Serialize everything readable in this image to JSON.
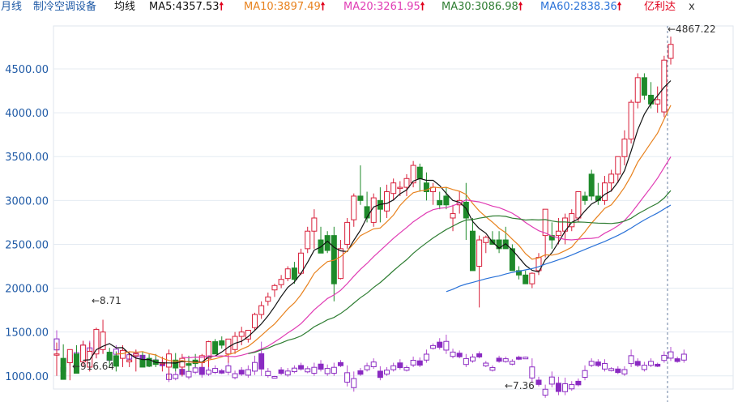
{
  "legend": {
    "period": "月线",
    "name": "制冷空调设备",
    "type": "均线",
    "ma5": {
      "label": "MA5:4357.53",
      "color": "#111111"
    },
    "ma10": {
      "label": "MA10:3897.49",
      "color": "#e8821e"
    },
    "ma20": {
      "label": "MA20:3261.95",
      "color": "#e03cb4"
    },
    "ma30": {
      "label": "MA30:3086.98",
      "color": "#2e7d32"
    },
    "ma60": {
      "label": "MA60:2838.36",
      "color": "#2a72d8"
    },
    "up_arrow": "🠕",
    "extra": "亿利达",
    "close": "x"
  },
  "chart_data": {
    "type": "candlestick",
    "ylim": [
      850,
      4990
    ],
    "y_ticks": [
      "1000.00",
      "1500.00",
      "2000.00",
      "2500.00",
      "3000.00",
      "3500.00",
      "4000.00",
      "4500.00"
    ],
    "up_color": "#d81f3a",
    "down_color": "#1e8a2a",
    "candles": [
      [
        1250,
        1380,
        1000,
        1250
      ],
      [
        1200,
        1360,
        1050,
        960
      ],
      [
        1150,
        1280,
        950,
        1300
      ],
      [
        1250,
        1350,
        1150,
        1030
      ],
      [
        1160,
        1400,
        1100,
        1350
      ],
      [
        1100,
        1380,
        1050,
        1280
      ],
      [
        1250,
        1550,
        1200,
        1530
      ],
      [
        1300,
        1640,
        1250,
        1500
      ],
      [
        1270,
        1320,
        1100,
        1180
      ],
      [
        1230,
        1280,
        1050,
        1110
      ],
      [
        1200,
        1350,
        1100,
        1290
      ],
      [
        1160,
        1250,
        1100,
        1180
      ],
      [
        1230,
        1300,
        1050,
        1250
      ],
      [
        1180,
        1280,
        1100,
        1100
      ],
      [
        1200,
        1250,
        1100,
        1110
      ],
      [
        1180,
        1250,
        1100,
        1130
      ],
      [
        1150,
        1220,
        1050,
        1150
      ],
      [
        1100,
        1300,
        960,
        1250
      ],
      [
        1180,
        1260,
        1050,
        1090
      ],
      [
        1100,
        1250,
        1000,
        1200
      ],
      [
        1140,
        1230,
        1050,
        1120
      ],
      [
        1180,
        1250,
        1100,
        1140
      ],
      [
        1150,
        1250,
        1100,
        1230
      ],
      [
        1200,
        1400,
        1100,
        1390
      ],
      [
        1390,
        1420,
        1350,
        1250
      ],
      [
        1400,
        1450,
        1310,
        1350
      ],
      [
        1250,
        1300,
        1150,
        1420
      ],
      [
        1300,
        1500,
        1250,
        1450
      ],
      [
        1450,
        1560,
        1350,
        1500
      ],
      [
        1420,
        1480,
        1380,
        1520
      ],
      [
        1550,
        1720,
        1520,
        1700
      ],
      [
        1700,
        1850,
        1650,
        1800
      ],
      [
        1850,
        1950,
        1800,
        1900
      ],
      [
        1980,
        2050,
        1900,
        2030
      ],
      [
        2040,
        2150,
        2000,
        2100
      ],
      [
        2110,
        2250,
        2080,
        2220
      ],
      [
        2230,
        2300,
        2050,
        2100
      ],
      [
        2170,
        2450,
        2150,
        2400
      ],
      [
        2450,
        2700,
        2400,
        2650
      ],
      [
        2650,
        2900,
        2450,
        2800
      ],
      [
        2550,
        2700,
        2400,
        2400
      ],
      [
        2600,
        2650,
        2400,
        2430
      ],
      [
        2600,
        2700,
        1850,
        2050
      ],
      [
        2110,
        2550,
        2100,
        2450
      ],
      [
        2500,
        2800,
        2450,
        2750
      ],
      [
        2780,
        3080,
        2700,
        3050
      ],
      [
        3050,
        3400,
        2950,
        3000
      ],
      [
        2930,
        3100,
        2750,
        2800
      ],
      [
        2750,
        3080,
        2700,
        3030
      ],
      [
        3000,
        3150,
        2750,
        2900
      ],
      [
        2880,
        3180,
        2800,
        3100
      ],
      [
        3080,
        3250,
        3000,
        3200
      ],
      [
        3150,
        3220,
        3050,
        3150
      ],
      [
        3150,
        3300,
        3050,
        3250
      ],
      [
        3200,
        3450,
        3150,
        3400
      ],
      [
        3380,
        3420,
        3100,
        3250
      ],
      [
        3200,
        3320,
        3000,
        3100
      ],
      [
        3100,
        3200,
        2950,
        3150
      ],
      [
        3000,
        3100,
        2900,
        2950
      ],
      [
        3050,
        3150,
        2900,
        2950
      ],
      [
        2800,
        2950,
        2650,
        2850
      ],
      [
        2950,
        3100,
        2850,
        3000
      ],
      [
        2980,
        3200,
        2550,
        2800
      ],
      [
        2650,
        2800,
        2200,
        2200
      ],
      [
        2250,
        2600,
        1780,
        2550
      ],
      [
        2520,
        2600,
        2400,
        2580
      ],
      [
        2550,
        2650,
        2500,
        2500
      ],
      [
        2550,
        2650,
        2400,
        2450
      ],
      [
        2550,
        2700,
        2450,
        2450
      ],
      [
        2450,
        2500,
        2300,
        2200
      ],
      [
        2200,
        2250,
        2100,
        2150
      ],
      [
        2150,
        2200,
        2050,
        2050
      ],
      [
        2050,
        2180,
        2000,
        2170
      ],
      [
        2200,
        2400,
        2150,
        2350
      ],
      [
        2600,
        2900,
        2350,
        2900
      ],
      [
        2600,
        2750,
        2450,
        2550
      ],
      [
        2600,
        2800,
        2500,
        2650
      ],
      [
        2650,
        2850,
        2500,
        2800
      ],
      [
        2700,
        2900,
        2650,
        2850
      ],
      [
        2800,
        3100,
        2750,
        3100
      ],
      [
        3050,
        3100,
        2950,
        3000
      ],
      [
        3300,
        3350,
        3000,
        3050
      ],
      [
        3050,
        3200,
        2950,
        3000
      ],
      [
        3000,
        3280,
        2950,
        3200
      ],
      [
        3200,
        3350,
        3100,
        3300
      ],
      [
        3300,
        3450,
        3200,
        3500
      ],
      [
        3500,
        3800,
        3400,
        3700
      ],
      [
        3700,
        4150,
        3650,
        4120
      ],
      [
        4120,
        4450,
        4050,
        4400
      ],
      [
        4400,
        4450,
        4150,
        4200
      ],
      [
        4200,
        4350,
        4050,
        4100
      ],
      [
        4100,
        4300,
        4000,
        4150
      ],
      [
        4010,
        4650,
        3950,
        4600
      ],
      [
        4620,
        4867.22,
        4550,
        4780
      ]
    ],
    "volumes": [
      [
        1240,
        1520
      ],
      [
        1030,
        1130
      ],
      [
        1120,
        1300
      ],
      [
        1180,
        1310
      ],
      [
        1260,
        1400
      ],
      [
        1170,
        1400
      ],
      [
        1200,
        1510
      ],
      [
        1260,
        1520
      ],
      [
        1150,
        1280
      ],
      [
        1220,
        1350
      ],
      [
        1210,
        1320
      ],
      [
        1170,
        1280
      ],
      [
        1200,
        1290
      ],
      [
        1170,
        1270
      ],
      [
        1100,
        1230
      ],
      [
        1150,
        1200
      ],
      [
        1100,
        1180
      ],
      [
        930,
        1070
      ],
      [
        950,
        1050
      ],
      [
        990,
        1120
      ],
      [
        960,
        1100
      ],
      [
        1020,
        1130
      ],
      [
        980,
        1160
      ],
      [
        1000,
        1100
      ],
      [
        1020,
        1120
      ],
      [
        1020,
        1080
      ],
      [
        1010,
        1170
      ],
      [
        960,
        1060
      ],
      [
        1000,
        1100
      ],
      [
        980,
        1120
      ],
      [
        1010,
        1230
      ],
      [
        1000,
        1390
      ],
      [
        980,
        1090
      ],
      [
        980,
        1000
      ],
      [
        1010,
        1100
      ],
      [
        990,
        1090
      ],
      [
        1030,
        1120
      ],
      [
        1060,
        1150
      ],
      [
        1030,
        1110
      ],
      [
        1000,
        1150
      ],
      [
        1050,
        1180
      ],
      [
        1000,
        1130
      ],
      [
        1000,
        1150
      ],
      [
        1100,
        1180
      ],
      [
        880,
        1120
      ],
      [
        820,
        1050
      ],
      [
        1000,
        1090
      ],
      [
        1050,
        1150
      ],
      [
        1080,
        1200
      ],
      [
        950,
        1110
      ],
      [
        1000,
        1100
      ],
      [
        1050,
        1150
      ],
      [
        1070,
        1190
      ],
      [
        1050,
        1120
      ],
      [
        1100,
        1220
      ],
      [
        1100,
        1210
      ],
      [
        1150,
        1300
      ],
      [
        1300,
        1370
      ],
      [
        1300,
        1430
      ],
      [
        1250,
        1470
      ],
      [
        1200,
        1310
      ],
      [
        1200,
        1290
      ],
      [
        1100,
        1250
      ],
      [
        1150,
        1250
      ],
      [
        1200,
        1280
      ],
      [
        1100,
        1170
      ],
      [
        1050,
        1120
      ],
      [
        1150,
        1230
      ],
      [
        1150,
        1220
      ],
      [
        1120,
        1190
      ],
      [
        1180,
        1230
      ],
      [
        1200,
        1220
      ],
      [
        920,
        1200
      ],
      [
        880,
        990
      ],
      [
        750,
        900
      ],
      [
        870,
        1050
      ],
      [
        780,
        990
      ],
      [
        780,
        980
      ],
      [
        830,
        940
      ],
      [
        880,
        970
      ],
      [
        950,
        1120
      ],
      [
        1100,
        1200
      ],
      [
        1100,
        1190
      ],
      [
        1050,
        1190
      ],
      [
        1050,
        1100
      ],
      [
        1020,
        1110
      ],
      [
        1000,
        1110
      ],
      [
        1100,
        1300
      ],
      [
        1100,
        1200
      ],
      [
        1050,
        1160
      ],
      [
        1100,
        1200
      ],
      [
        1100,
        1150
      ],
      [
        1150,
        1280
      ],
      [
        1170,
        1330
      ],
      [
        1150,
        1220
      ],
      [
        1150,
        1300
      ]
    ],
    "annotations": {
      "max_label": "←4867.22",
      "top_left_label": "←8.71",
      "low_left_label": "←916.64",
      "low_mid_label": "←7.36"
    }
  }
}
